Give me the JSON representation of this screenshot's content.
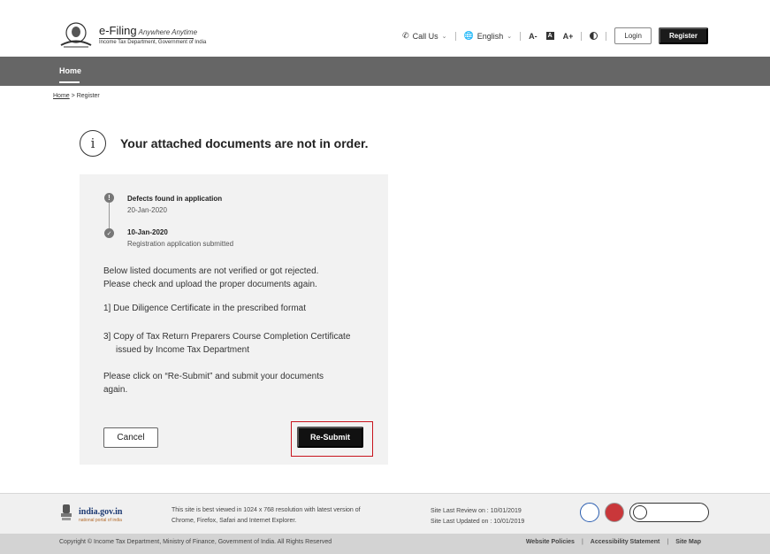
{
  "header": {
    "brand_title": "e-Filing",
    "brand_tagline": "Anywhere Anytime",
    "brand_subtitle": "Income Tax Department, Government of India",
    "call_us": "Call Us",
    "language": "English",
    "font_decrease": "A-",
    "font_normal": "A",
    "font_increase": "A+",
    "login_label": "Login",
    "register_label": "Register"
  },
  "menu": {
    "home": "Home"
  },
  "breadcrumb": {
    "home": "Home",
    "separator": ">",
    "current": "Register"
  },
  "main": {
    "heading": "Your attached documents are not in order.",
    "timeline": [
      {
        "title": "Defects found in application",
        "sub": "20-Jan-2020",
        "icon": "exclamation-icon"
      },
      {
        "title": "10-Jan-2020",
        "sub": "Registration application submitted",
        "icon": "check-icon"
      }
    ],
    "intro_line1": "Below listed documents are not verified or got rejected.",
    "intro_line2": "Please check and upload the proper documents again.",
    "docs": [
      {
        "line1": "1]  Due Diligence Certificate in the prescribed format"
      },
      {
        "line1": "3]  Copy of Tax Return Preparers Course Completion Certificate",
        "line2": "issued by Income Tax Department"
      }
    ],
    "instruction_line1": "Please click on “Re-Submit” and submit your documents",
    "instruction_line2": "again.",
    "cancel_label": "Cancel",
    "resubmit_label": "Re-Submit"
  },
  "footer": {
    "portal_name": "india.gov.in",
    "portal_sub": "national portal of india",
    "best_view_line1": "This site is best viewed in 1024 x 768 resolution with latest version of",
    "best_view_line2": "Chrome, Firefox, Safari and Internet Explorer.",
    "review_line": "Site Last Review on  :  10/01/2019",
    "updated_line": "Site Last Updated on  : 10/01/2019",
    "copyright": "Copyright © Income Tax Department, Ministry of Finance, Government of India. All Rights Reserved",
    "links": [
      "Website Policies",
      "Accessibility Statement",
      "Site Map"
    ]
  },
  "colors": {
    "menu_bg": "#666666",
    "panel_bg": "#f2f2f2",
    "highlight": "#c8141d",
    "primary_button": "#111111"
  }
}
